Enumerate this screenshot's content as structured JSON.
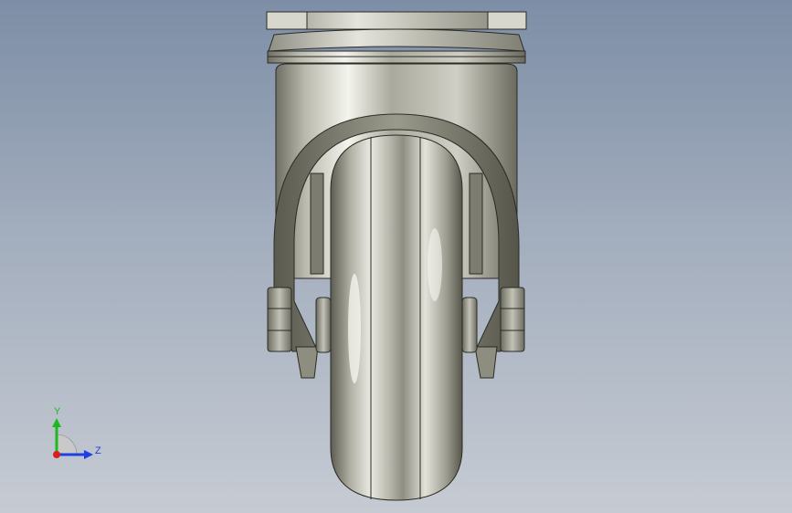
{
  "viewport": {
    "background_top": "#7d8ea6",
    "background_bottom": "#c6cbd3"
  },
  "model": {
    "metal_light": "#d8d8cf",
    "metal_mid": "#a8a89a",
    "metal_dark": "#5a5a50",
    "edge": "#2b2b26"
  },
  "triad": {
    "y_label": "Y",
    "z_label": "Z",
    "y_color": "#1fb81f",
    "z_color": "#1f3fe0",
    "x_color": "#d81f1f"
  }
}
